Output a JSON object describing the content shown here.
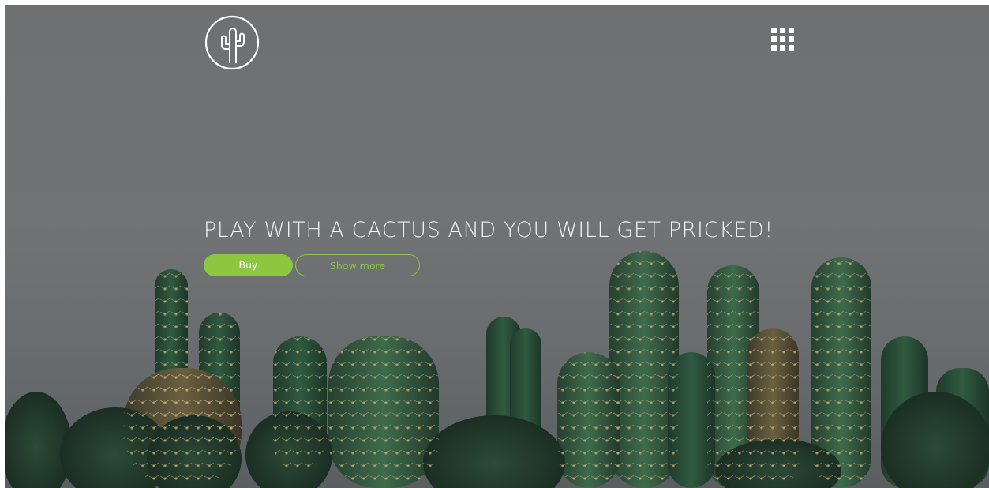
{
  "header": {
    "logo_icon": "cactus-logo-icon",
    "menu_icon": "grid-menu-icon"
  },
  "hero": {
    "headline": "PLAY WITH A CACTUS AND YOU WILL GET PRICKED!",
    "buy_label": "Buy",
    "show_more_label": "Show more"
  },
  "colors": {
    "accent": "#8dc63f",
    "overlay": "#6e7072",
    "text": "#f2f2f2"
  }
}
